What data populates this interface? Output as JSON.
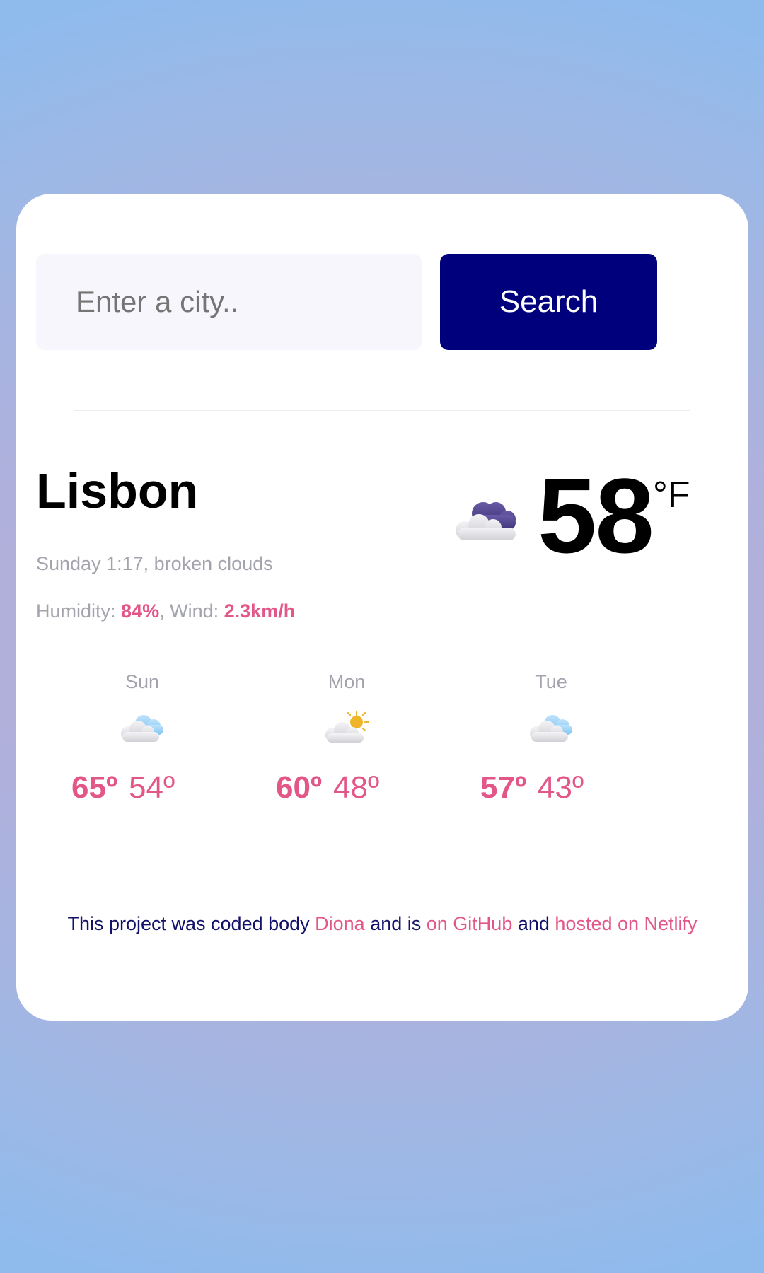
{
  "search": {
    "placeholder": "Enter a city..",
    "button_label": "Search"
  },
  "current": {
    "city": "Lisbon",
    "date_desc": "Sunday 1:17, broken clouds",
    "humidity_label": "Humidity:",
    "humidity_value": "84%",
    "wind_label": ", Wind:",
    "wind_value": "2.3km/h",
    "temperature": "58",
    "unit": "°F",
    "icon": "broken-clouds-night-icon"
  },
  "forecast": [
    {
      "day": "Sun",
      "max": "65º",
      "min": "54º",
      "icon": "clouds-icon"
    },
    {
      "day": "Mon",
      "max": "60º",
      "min": "48º",
      "icon": "partly-sunny-icon"
    },
    {
      "day": "Tue",
      "max": "57º",
      "min": "43º",
      "icon": "clouds-icon"
    }
  ],
  "footer": {
    "text1": "This project was coded body ",
    "link1": "Diona",
    "text2": " and is ",
    "link2": "on GitHub",
    "text3": " and ",
    "link3": "hosted on Netlify"
  },
  "colors": {
    "accent": "#e25688",
    "button": "#00007c",
    "footer_text": "#12126b",
    "muted_text": "#a3a3ad"
  }
}
